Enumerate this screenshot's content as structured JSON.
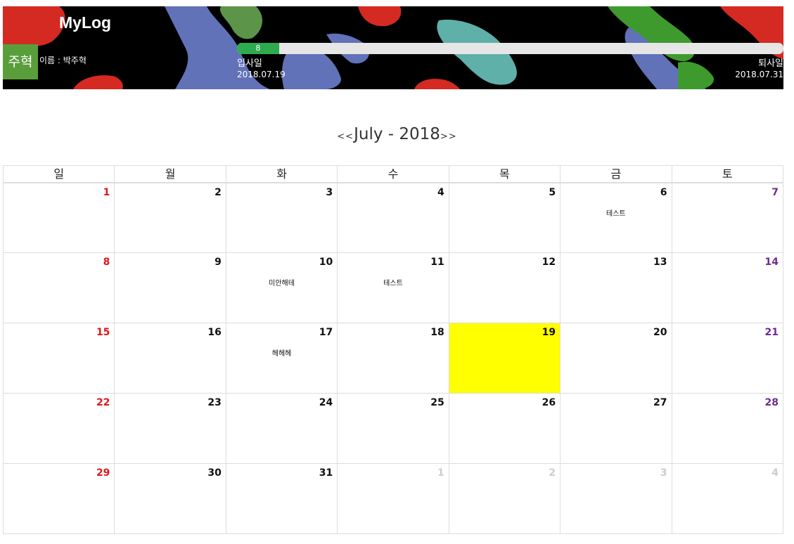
{
  "header": {
    "logo": "MyLog",
    "avatar_text": "주혁",
    "name_label": "이름 : 박주혁",
    "progress_value": "8",
    "progress_fraction": 0.077,
    "start_label": "입사일",
    "start_date": "2018.07.19",
    "end_label": "퇴사일",
    "end_date": "2018.07.31"
  },
  "month_nav": {
    "prev": "<<",
    "title": "July - 2018",
    "next": ">>"
  },
  "weekdays": [
    "일",
    "월",
    "화",
    "수",
    "목",
    "금",
    "토"
  ],
  "weeks": [
    [
      {
        "day": "1"
      },
      {
        "day": "2"
      },
      {
        "day": "3"
      },
      {
        "day": "4"
      },
      {
        "day": "5"
      },
      {
        "day": "6",
        "event": "테스트"
      },
      {
        "day": "7"
      }
    ],
    [
      {
        "day": "8"
      },
      {
        "day": "9"
      },
      {
        "day": "10",
        "event": "미안해테"
      },
      {
        "day": "11",
        "event": "테스트"
      },
      {
        "day": "12"
      },
      {
        "day": "13"
      },
      {
        "day": "14"
      }
    ],
    [
      {
        "day": "15"
      },
      {
        "day": "16"
      },
      {
        "day": "17",
        "event": "헤헤헤"
      },
      {
        "day": "18"
      },
      {
        "day": "19",
        "today": true
      },
      {
        "day": "20"
      },
      {
        "day": "21"
      }
    ],
    [
      {
        "day": "22"
      },
      {
        "day": "23"
      },
      {
        "day": "24"
      },
      {
        "day": "25"
      },
      {
        "day": "26"
      },
      {
        "day": "27"
      },
      {
        "day": "28"
      }
    ],
    [
      {
        "day": "29"
      },
      {
        "day": "30"
      },
      {
        "day": "31"
      },
      {
        "day": "1",
        "other": true
      },
      {
        "day": "2",
        "other": true
      },
      {
        "day": "3",
        "other": true
      },
      {
        "day": "4",
        "other": true
      }
    ]
  ],
  "colors": {
    "sunday": "#e0161b",
    "saturday": "#6b2d8f",
    "today": "#ffff00",
    "progress": "#2eab4e",
    "avatar": "#5a9e3c"
  }
}
